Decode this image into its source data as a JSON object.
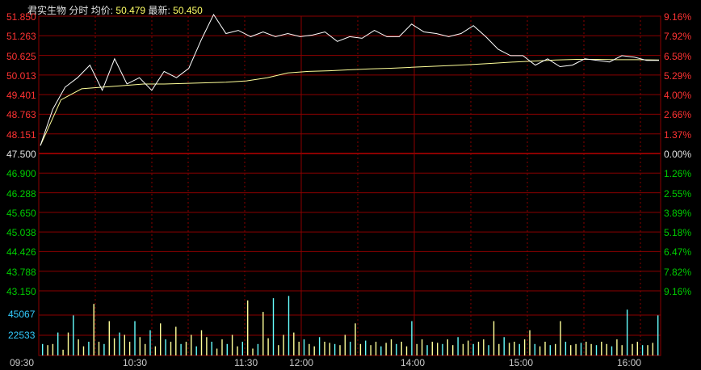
{
  "header": {
    "stock_name": "君实生物",
    "mode": "分时",
    "avg_label": "均价:",
    "avg_value": "50.479",
    "last_label": "最新:",
    "last_value": "50.450"
  },
  "colors": {
    "background": "#000000",
    "grid": "#8b0000",
    "up": "#ff3333",
    "down": "#00cc00",
    "neutral": "#e0e0e0",
    "price_line": "#ffffff",
    "avg_line": "#ffff99",
    "volume": "#ffff99"
  },
  "price_axis": {
    "labels": [
      "51.850",
      "51.263",
      "50.625",
      "50.013",
      "49.401",
      "48.763",
      "48.151",
      "47.500",
      "46.900",
      "46.288",
      "45.650",
      "45.038",
      "44.426",
      "43.788",
      "43.150"
    ],
    "pct_labels": [
      "9.16%",
      "7.92%",
      "6.58%",
      "5.29%",
      "4.00%",
      "2.66%",
      "1.37%",
      "0.00%",
      "1.26%",
      "2.55%",
      "3.89%",
      "5.18%",
      "6.47%",
      "7.82%",
      "9.16%"
    ]
  },
  "volume_axis": {
    "labels": [
      "45067",
      "22533"
    ]
  },
  "time_axis": {
    "labels": [
      "09:30",
      "10:30",
      "11:30",
      "12:00",
      "14:00",
      "15:00",
      "16:00"
    ]
  },
  "chart_data": {
    "type": "line",
    "title": "",
    "prev_close": 47.5,
    "ylim": [
      43.15,
      51.85
    ],
    "x": [
      "09:30",
      "10:30",
      "11:30",
      "12:00",
      "14:00",
      "15:00",
      "16:00"
    ],
    "series": [
      {
        "name": "",
        "values": [
          47.75,
          48.9,
          49.6,
          49.9,
          50.3,
          49.5,
          50.5,
          49.7,
          49.9,
          49.5,
          50.1,
          49.9,
          50.2,
          51.1,
          51.9,
          51.3,
          51.4,
          51.2,
          51.35,
          51.2,
          51.3,
          51.2,
          51.25,
          51.35,
          51.05,
          51.2,
          51.15,
          51.4,
          51.2,
          51.2,
          51.6,
          51.35,
          51.3,
          51.2,
          51.3,
          51.55,
          51.2,
          50.8,
          50.6,
          50.6,
          50.3,
          50.5,
          50.25,
          50.3,
          50.5,
          50.45,
          50.4,
          50.6,
          50.55,
          50.45,
          50.45
        ]
      },
      {
        "name": "",
        "values": [
          47.75,
          49.2,
          49.55,
          49.6,
          49.65,
          49.7,
          49.7,
          49.72,
          49.74,
          49.76,
          49.8,
          49.9,
          50.05,
          50.1,
          50.12,
          50.15,
          50.18,
          50.2,
          50.23,
          50.26,
          50.29,
          50.32,
          50.36,
          50.4,
          50.43,
          50.46,
          50.48,
          50.48,
          50.47,
          50.47,
          50.46
        ]
      }
    ],
    "volume": [
      10,
      9,
      10,
      20,
      5,
      20,
      35,
      14,
      8,
      12,
      45,
      12,
      10,
      30,
      15,
      20,
      18,
      12,
      30,
      16,
      10,
      22,
      8,
      28,
      14,
      12,
      25,
      10,
      12,
      18,
      8,
      22,
      16,
      12,
      6,
      14,
      10,
      18,
      8,
      12,
      48,
      6,
      10,
      38,
      15,
      50,
      9,
      18,
      52,
      20,
      12,
      14,
      10,
      8,
      16,
      12,
      11,
      10,
      9,
      18,
      12,
      28,
      10,
      13,
      9,
      12,
      8,
      11,
      14,
      10,
      12,
      8,
      30,
      10,
      14,
      9,
      12,
      11,
      10,
      14,
      9,
      16,
      10,
      13,
      10,
      12,
      14,
      9,
      30,
      10,
      16,
      11,
      12,
      10,
      14,
      22,
      10,
      8,
      12,
      9,
      10,
      30,
      12,
      9,
      10,
      11,
      12,
      10,
      9,
      12,
      10,
      8,
      14,
      9,
      40,
      10,
      12,
      9,
      9,
      11,
      35
    ],
    "volume_max": 45067
  }
}
